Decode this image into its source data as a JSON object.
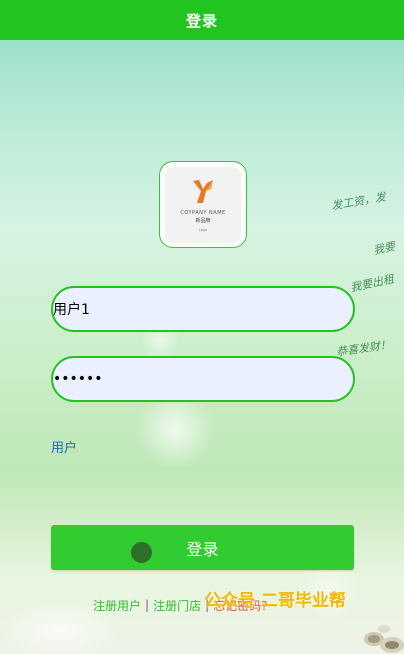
{
  "header": {
    "title": "登录"
  },
  "decor": {
    "line1": "发工资，发",
    "line2": "我要",
    "line3": "我要出租",
    "line4": "恭喜发财！"
  },
  "logo": {
    "brand_en": "COYPANY NAME",
    "brand_cn": "新品牌",
    "small": "Logo"
  },
  "form": {
    "username_value": "用户1",
    "password_value": "123456",
    "role_link": "用户",
    "login_label": "登录"
  },
  "footer": {
    "register_user": "注册用户",
    "separator": "|",
    "register_store": "注册门店",
    "forgot_password": "忘记密码?"
  },
  "watermark": "公众号 二哥毕业帮",
  "colors": {
    "header": "#22c41f",
    "button": "#32cb30",
    "field_border": "#22c41f",
    "field_bg": "#eaf0ff",
    "link_blue": "#1e69b4",
    "link_green": "#2fbf2c",
    "forgot_orange": "#e0572a",
    "watermark": "#f5b800"
  }
}
